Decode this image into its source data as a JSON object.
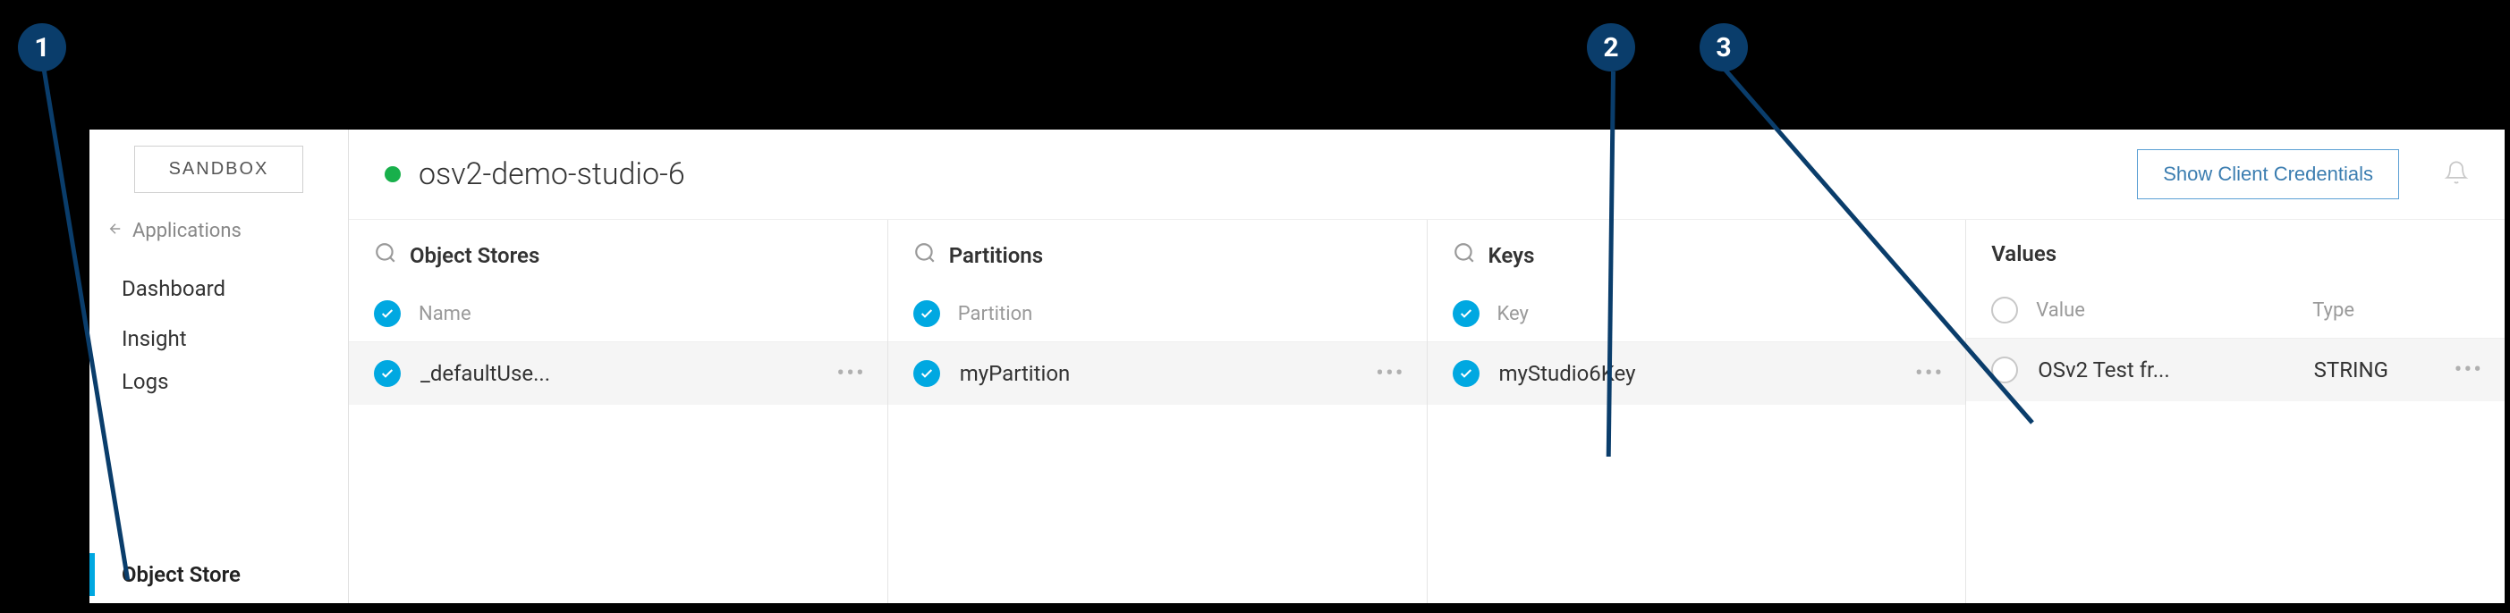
{
  "sidebar": {
    "env_label": "SANDBOX",
    "back_label": "Applications",
    "nav": [
      {
        "label": "Dashboard",
        "active": false
      },
      {
        "label": "Insight",
        "active": false
      },
      {
        "label": "Logs",
        "active": false
      },
      {
        "label": "Object Store",
        "active": true
      }
    ]
  },
  "header": {
    "status": "online",
    "app_name": "osv2-demo-studio-6",
    "show_credentials_label": "Show Client Credentials"
  },
  "columns": {
    "object_stores": {
      "title": "Object Stores",
      "subhead": "Name",
      "row_checked": true,
      "row_value": "_defaultUse..."
    },
    "partitions": {
      "title": "Partitions",
      "subhead": "Partition",
      "row_checked": true,
      "row_value": "myPartition"
    },
    "keys": {
      "title": "Keys",
      "subhead": "Key",
      "row_checked": true,
      "row_value": "myStudio6Key"
    },
    "values": {
      "title": "Values",
      "subhead_value": "Value",
      "subhead_type": "Type",
      "row_checked": false,
      "row_value": "OSv2 Test fr...",
      "row_type": "STRING"
    }
  },
  "annotations": {
    "c1": "1",
    "c2": "2",
    "c3": "3"
  }
}
